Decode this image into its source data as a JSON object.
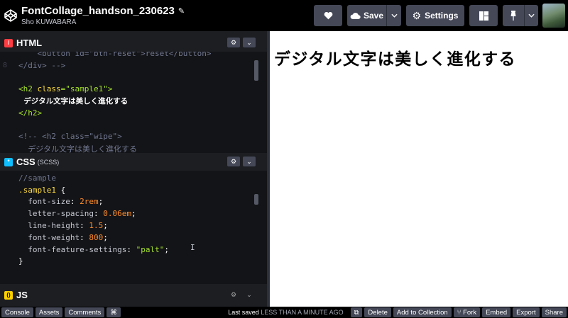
{
  "header": {
    "title": "FontCollage_handson_230623",
    "author": "Sho KUWABARA",
    "save_label": "Save",
    "settings_label": "Settings"
  },
  "panes": {
    "html": {
      "label": "HTML"
    },
    "css": {
      "label": "CSS",
      "sublabel": "(SCSS)"
    },
    "js": {
      "label": "JS"
    }
  },
  "html_code": [
    {
      "ln": "",
      "parts": [
        {
          "t": "    <button id=\"btn-reset\">reset</button>",
          "c": "c-comment"
        }
      ]
    },
    {
      "ln": "8",
      "parts": [
        {
          "t": "</div> -->",
          "c": "c-comment"
        }
      ]
    },
    {
      "ln": "",
      "parts": [
        {
          "t": "",
          "c": "c-plain"
        }
      ]
    },
    {
      "ln": "",
      "parts": [
        {
          "t": "<h2 ",
          "c": "c-tag"
        },
        {
          "t": "class",
          "c": "c-attr"
        },
        {
          "t": "=\"sample1\">",
          "c": "c-str"
        }
      ]
    },
    {
      "ln": "",
      "parts": [
        {
          "t": "  デジタル文字は美しく進化する",
          "c": "c-jp"
        }
      ]
    },
    {
      "ln": "",
      "parts": [
        {
          "t": "</h2>",
          "c": "c-tag"
        }
      ]
    },
    {
      "ln": "",
      "parts": [
        {
          "t": "",
          "c": "c-plain"
        }
      ]
    },
    {
      "ln": "",
      "parts": [
        {
          "t": "<!-- <h2 class=\"wipe\">",
          "c": "c-comment"
        }
      ]
    },
    {
      "ln": "",
      "parts": [
        {
          "t": "  デジタル文字は美しく進化する",
          "c": "c-comment"
        }
      ]
    }
  ],
  "css_code": [
    {
      "ln": "",
      "parts": [
        {
          "t": "//sample",
          "c": "c-comment"
        }
      ]
    },
    {
      "ln": "",
      "parts": [
        {
          "t": ".sample1 ",
          "c": "c-sel"
        },
        {
          "t": "{",
          "c": "c-plain"
        }
      ]
    },
    {
      "ln": "",
      "parts": [
        {
          "t": "  font-size",
          "c": "c-prop"
        },
        {
          "t": ": ",
          "c": "c-plain"
        },
        {
          "t": "2rem",
          "c": "c-num"
        },
        {
          "t": ";",
          "c": "c-plain"
        }
      ]
    },
    {
      "ln": "",
      "parts": [
        {
          "t": "  letter-spacing",
          "c": "c-prop"
        },
        {
          "t": ": ",
          "c": "c-plain"
        },
        {
          "t": "0.06em",
          "c": "c-num"
        },
        {
          "t": ";",
          "c": "c-plain"
        }
      ]
    },
    {
      "ln": "",
      "parts": [
        {
          "t": "  line-height",
          "c": "c-prop"
        },
        {
          "t": ": ",
          "c": "c-plain"
        },
        {
          "t": "1.5",
          "c": "c-num"
        },
        {
          "t": ";",
          "c": "c-plain"
        }
      ]
    },
    {
      "ln": "",
      "parts": [
        {
          "t": "  font-weight",
          "c": "c-prop"
        },
        {
          "t": ": ",
          "c": "c-plain"
        },
        {
          "t": "800",
          "c": "c-num"
        },
        {
          "t": ";",
          "c": "c-plain"
        }
      ]
    },
    {
      "ln": "",
      "parts": [
        {
          "t": "  font-feature-settings",
          "c": "c-prop"
        },
        {
          "t": ": ",
          "c": "c-plain"
        },
        {
          "t": "\"palt\"",
          "c": "c-str"
        },
        {
          "t": ";",
          "c": "c-plain"
        }
      ]
    },
    {
      "ln": "",
      "parts": [
        {
          "t": "}",
          "c": "c-plain"
        }
      ]
    },
    {
      "ln": "",
      "parts": [
        {
          "t": "",
          "c": "c-plain"
        }
      ]
    }
  ],
  "preview": {
    "heading": "デジタル文字は美しく進化する"
  },
  "footer": {
    "console": "Console",
    "assets": "Assets",
    "comments": "Comments",
    "shortcut": "⌘",
    "saved_prefix": "Last saved",
    "saved_time": "LESS THAN A MINUTE AGO",
    "delete": "Delete",
    "add_to_collection": "Add to Collection",
    "fork": "Fork",
    "embed": "Embed",
    "export": "Export",
    "share": "Share"
  }
}
